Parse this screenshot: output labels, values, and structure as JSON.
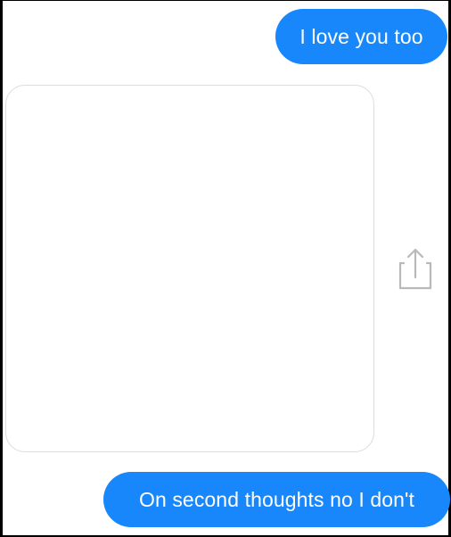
{
  "messages": [
    {
      "text": "I love you too",
      "side": "right",
      "type": "text"
    },
    {
      "text": "On second thoughts no I don't",
      "side": "right",
      "type": "text"
    }
  ],
  "attachment": {
    "type": "image",
    "share_icon": "share-icon"
  },
  "colors": {
    "outgoing_bubble": "#1787fb",
    "outgoing_text": "#ffffff",
    "share_icon": "#b9b9b9",
    "image_border": "#dcdcdc"
  }
}
